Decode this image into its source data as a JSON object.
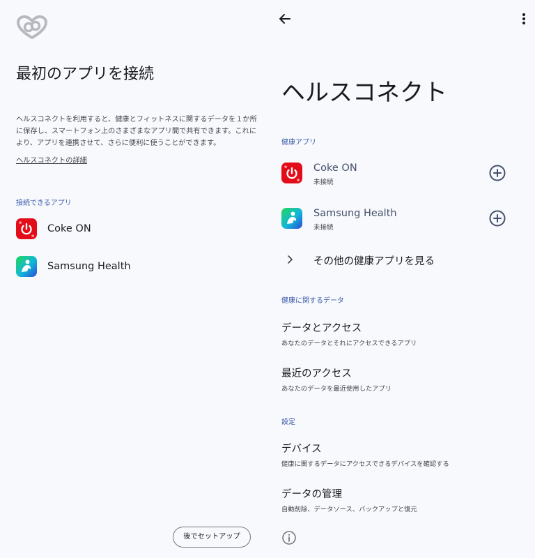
{
  "colors": {
    "background": "#f8f9fd",
    "accent": "#3b5ba9",
    "icon_dark": "#44506a",
    "logo_gray": "#b7b9bf",
    "coke_red": "#e30d1a",
    "outline": "#74777f"
  },
  "onboarding": {
    "logo_icon": "health-connect-logo",
    "title": "最初のアプリを接続",
    "description": "ヘルスコネクトを利用すると、健康とフィットネスに関するデータを１か所に保存し、スマートフォン上のさまざまなアプリ間で共有できます。これにより、アプリを連携させて、さらに便利に使うことができます。",
    "details_link": "ヘルスコネクトの詳細",
    "section_label": "接続できるアプリ",
    "apps": [
      {
        "name": "Coke ON",
        "icon": "coke-on-icon"
      },
      {
        "name": "Samsung Health",
        "icon": "samsung-health-icon"
      }
    ],
    "setup_later_button": "後でセットアップ"
  },
  "health_connect": {
    "back_icon": "arrow-back-icon",
    "more_icon": "more-vert-icon",
    "title": "ヘルスコネクト",
    "health_apps_label": "健康アプリ",
    "apps": [
      {
        "name": "Coke ON",
        "status": "未接続",
        "icon": "coke-on-icon",
        "action_icon": "add-circle-icon"
      },
      {
        "name": "Samsung Health",
        "status": "未接続",
        "icon": "samsung-health-icon",
        "action_icon": "add-circle-icon"
      }
    ],
    "see_more_apps": "その他の健康アプリを見る",
    "health_data_label": "健康に関するデータ",
    "data_items": [
      {
        "title": "データとアクセス",
        "subtitle": "あなたのデータとそれにアクセスできるアプリ"
      },
      {
        "title": "最近のアクセス",
        "subtitle": "あなたのデータを最近使用したアプリ"
      }
    ],
    "settings_label": "設定",
    "settings_items": [
      {
        "title": "デバイス",
        "subtitle": "健康に関するデータにアクセスできるデバイスを確認する"
      },
      {
        "title": "データの管理",
        "subtitle": "自動削除、データソース、バックアップと復元"
      }
    ],
    "info_icon": "info-icon"
  }
}
